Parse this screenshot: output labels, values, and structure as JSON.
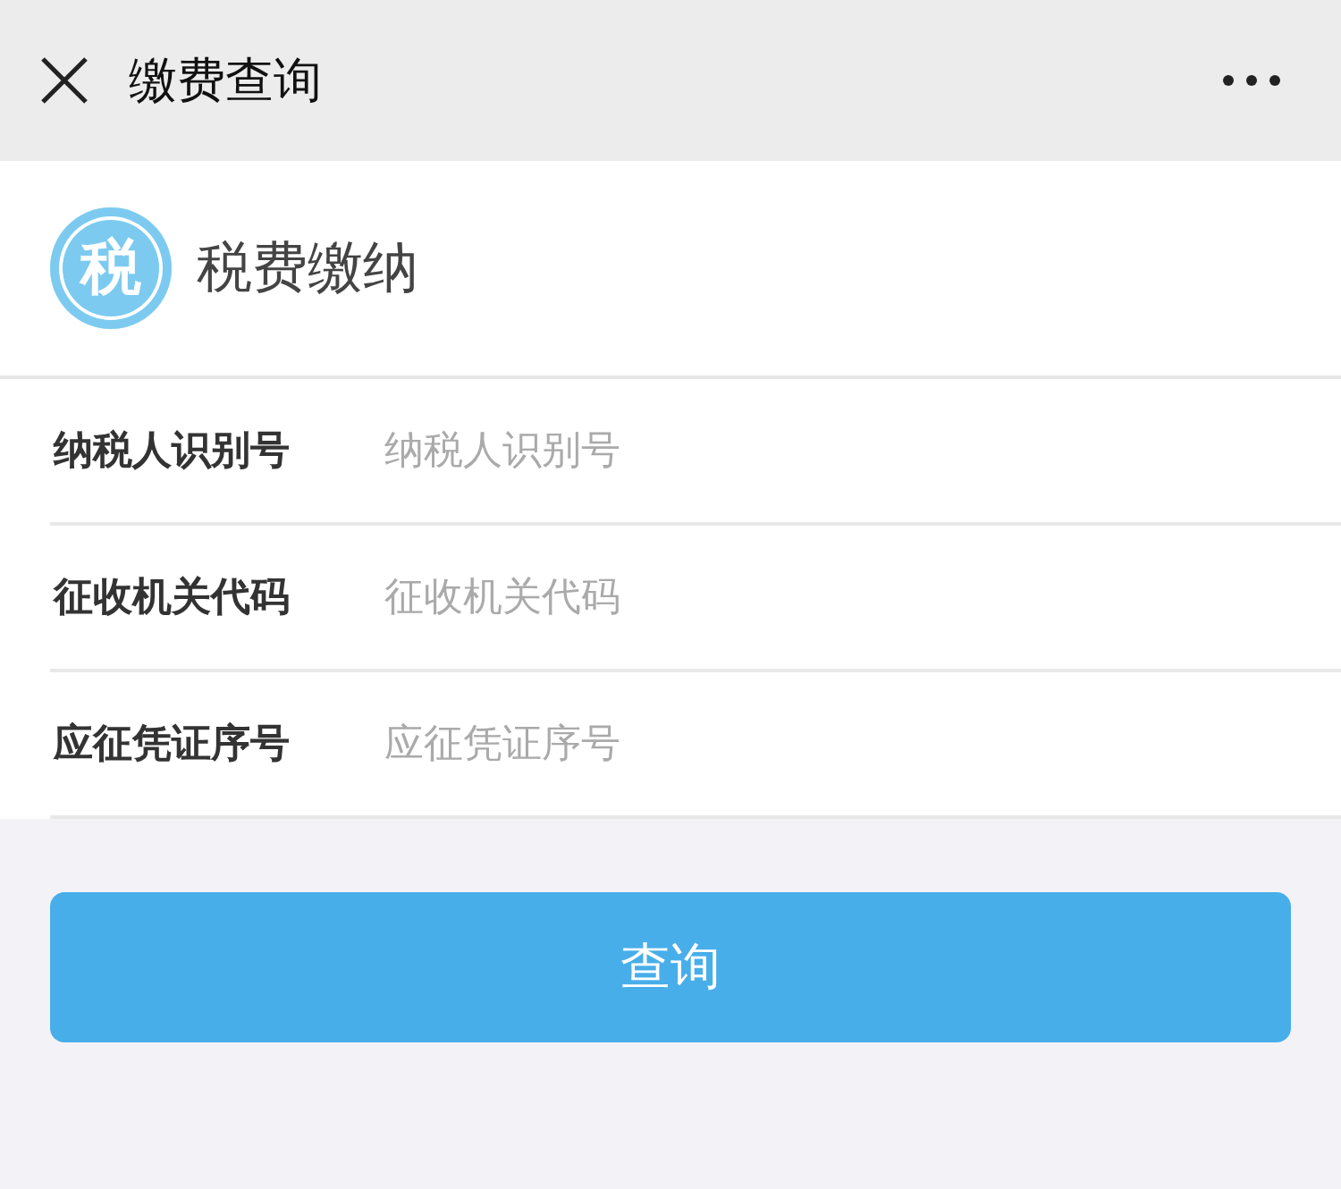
{
  "header": {
    "title": "缴费查询"
  },
  "brand": {
    "logo_glyph": "税",
    "title": "税费缴纳"
  },
  "fields": [
    {
      "label": "纳税人识别号",
      "placeholder": "纳税人识别号"
    },
    {
      "label": "征收机关代码",
      "placeholder": "征收机关代码"
    },
    {
      "label": "应征凭证序号",
      "placeholder": "应征凭证序号"
    }
  ],
  "submit_button": {
    "label": "查询"
  }
}
